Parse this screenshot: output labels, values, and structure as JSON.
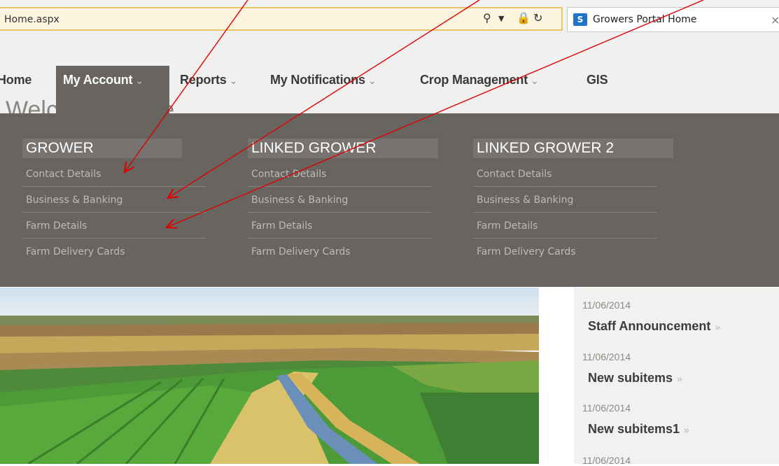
{
  "browser": {
    "address_url": "Home.aspx",
    "tab_title": "Growers Portal Home",
    "sp_logo": "S"
  },
  "nav": {
    "items": [
      {
        "label": "Home"
      },
      {
        "label": "My Account",
        "active": true
      },
      {
        "label": "Reports"
      },
      {
        "label": "My Notifications"
      },
      {
        "label": "Crop Management"
      },
      {
        "label": "GIS"
      }
    ],
    "chevron": "⌄",
    "page_title_partial": "Welcome Home"
  },
  "dropdown": {
    "columns": [
      {
        "heading": "GROWER",
        "links": [
          "Contact Details",
          "Business & Banking",
          "Farm Details",
          "Farm Delivery Cards"
        ]
      },
      {
        "heading": "LINKED GROWER",
        "links": [
          "Contact Details",
          "Business & Banking",
          "Farm Details",
          "Farm Delivery Cards"
        ]
      },
      {
        "heading": "LINKED GROWER 2",
        "links": [
          "Contact Details",
          "Business & Banking",
          "Farm Details",
          "Farm Delivery Cards"
        ]
      }
    ]
  },
  "news": [
    {
      "date": "11/06/2014",
      "title": "Staff Announcement"
    },
    {
      "date": "11/06/2014",
      "title": "New subitems"
    },
    {
      "date": "11/06/2014",
      "title": "New subitems1"
    },
    {
      "date": "11/06/2014",
      "title": ""
    }
  ],
  "news_arrow": "»",
  "colors": {
    "nav_active": "#686460",
    "dropdown_bg": "#686460",
    "annotation_arrow": "#e00000"
  }
}
